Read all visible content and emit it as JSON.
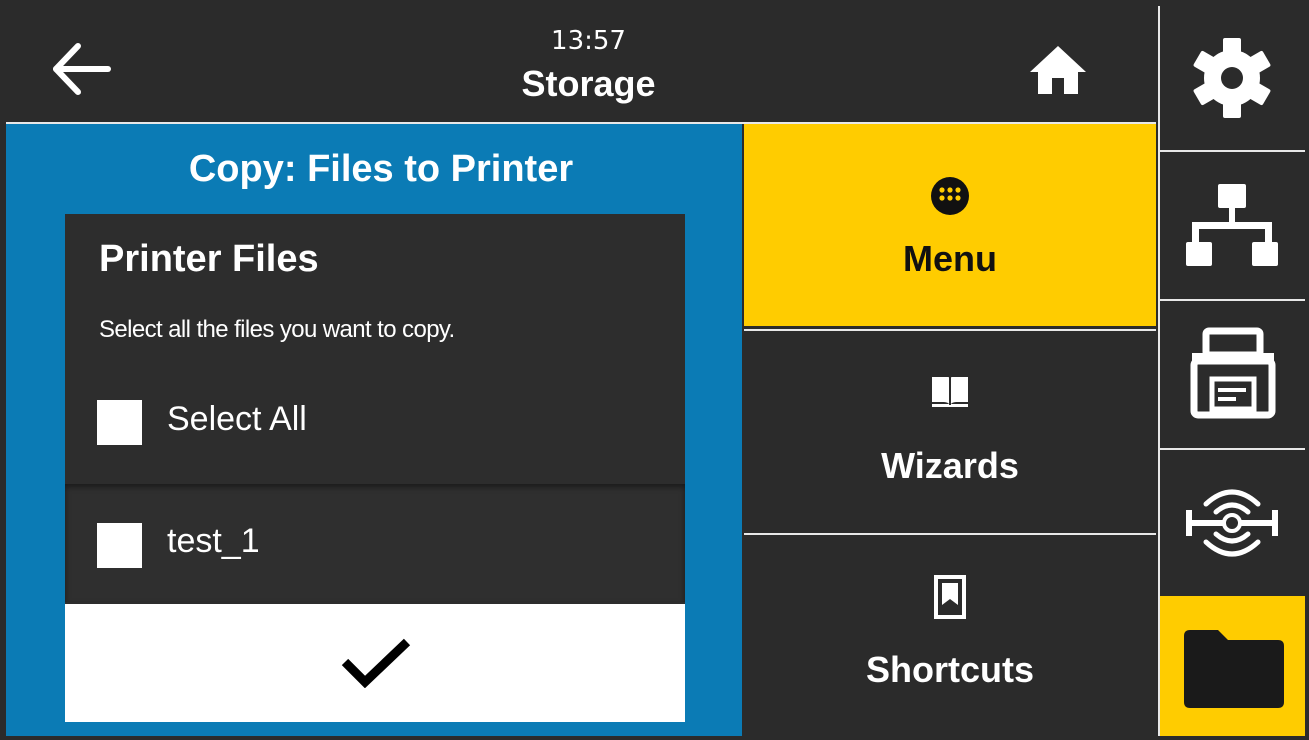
{
  "header": {
    "time": "13:57",
    "title": "Storage"
  },
  "panel": {
    "title": "Copy: Files to Printer",
    "dialog": {
      "heading": "Printer Files",
      "description": "Select all the files you want to copy.",
      "select_all_label": "Select All",
      "files": [
        {
          "name": "test_1",
          "checked": false
        }
      ]
    }
  },
  "nav": {
    "items": [
      {
        "label": "Menu",
        "icon": "menu-dots-icon",
        "active": true
      },
      {
        "label": "Wizards",
        "icon": "book-icon",
        "active": false
      },
      {
        "label": "Shortcuts",
        "icon": "bookmark-icon",
        "active": false
      }
    ]
  },
  "sidebar": {
    "items": [
      {
        "icon": "gear-icon",
        "active": false
      },
      {
        "icon": "network-icon",
        "active": false
      },
      {
        "icon": "printer-icon",
        "active": false
      },
      {
        "icon": "rfid-icon",
        "active": false
      },
      {
        "icon": "folder-icon",
        "active": true
      }
    ]
  },
  "colors": {
    "background": "#2b2b2b",
    "accent": "#ffcc00",
    "panel_blue": "#0b7bb5",
    "divider": "#e8e8e8"
  }
}
